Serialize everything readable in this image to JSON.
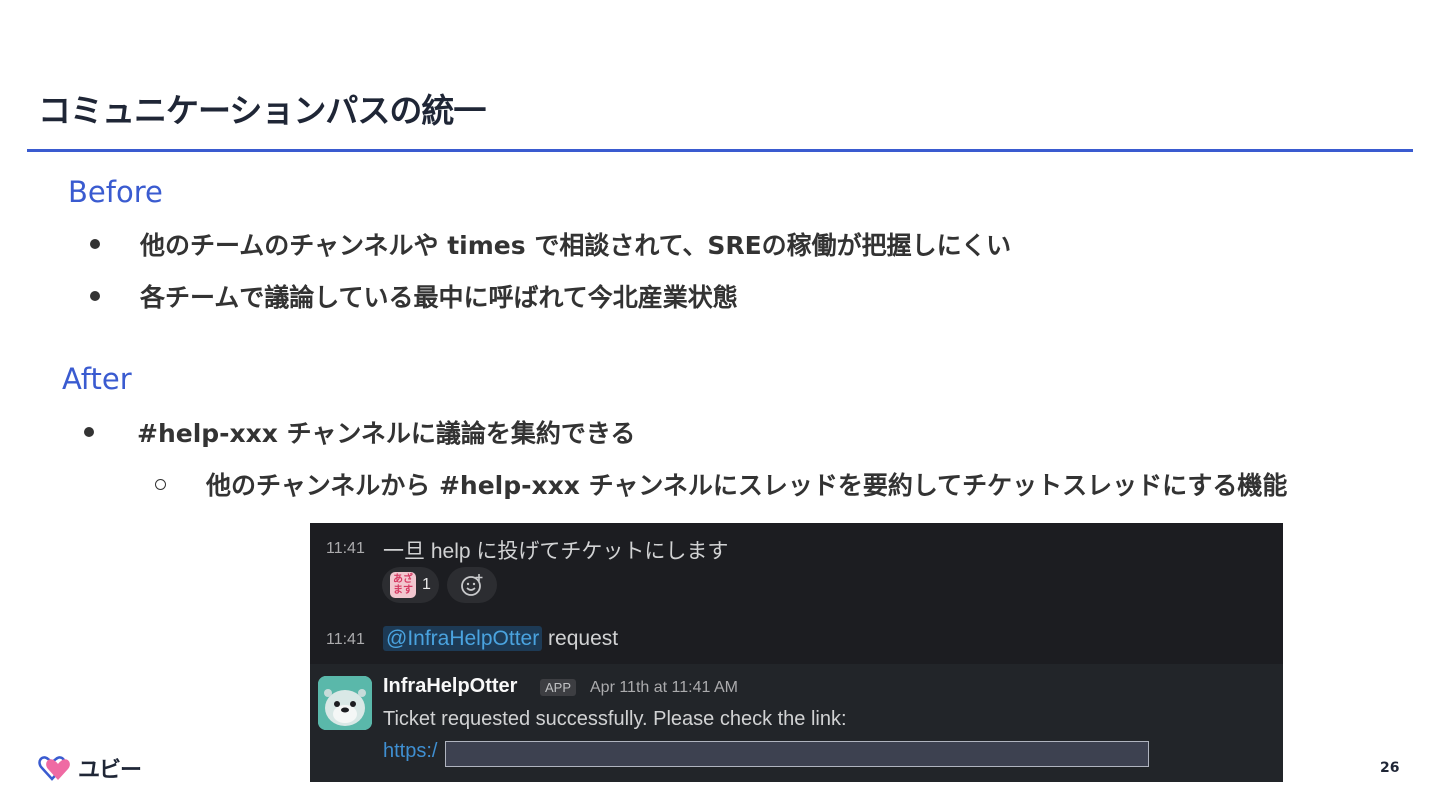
{
  "slide": {
    "title": "コミュニケーションパスの統一",
    "page_number": "26",
    "logo_text": "ユビー",
    "accent_color": "#3a5bd0"
  },
  "before": {
    "heading": "Before",
    "bullets": [
      "他のチームのチャンネルや times で相談されて、SREの稼働が把握しにくい",
      "各チームで議論している最中に呼ばれて今北産業状態"
    ]
  },
  "after": {
    "heading": "After",
    "bullets": [
      "#help-xxx チャンネルに議論を集約できる"
    ],
    "sub_bullets": [
      "他のチャンネルから #help-xxx チャンネルにスレッドを要約してチケットスレッドにする機能"
    ]
  },
  "chat": {
    "messages": [
      {
        "time": "11:41",
        "text": "一旦 help に投げてチケットにします"
      },
      {
        "time": "11:41",
        "mention": "@InfraHelpOtter",
        "text": " request"
      }
    ],
    "reaction": {
      "emoji_text": "あざます",
      "count": "1"
    },
    "bot": {
      "name": "InfraHelpOtter",
      "tag": "APP",
      "timestamp": "Apr 11th at 11:41 AM",
      "text": "Ticket requested successfully. Please check the link:",
      "link_prefix": "https:/"
    }
  }
}
